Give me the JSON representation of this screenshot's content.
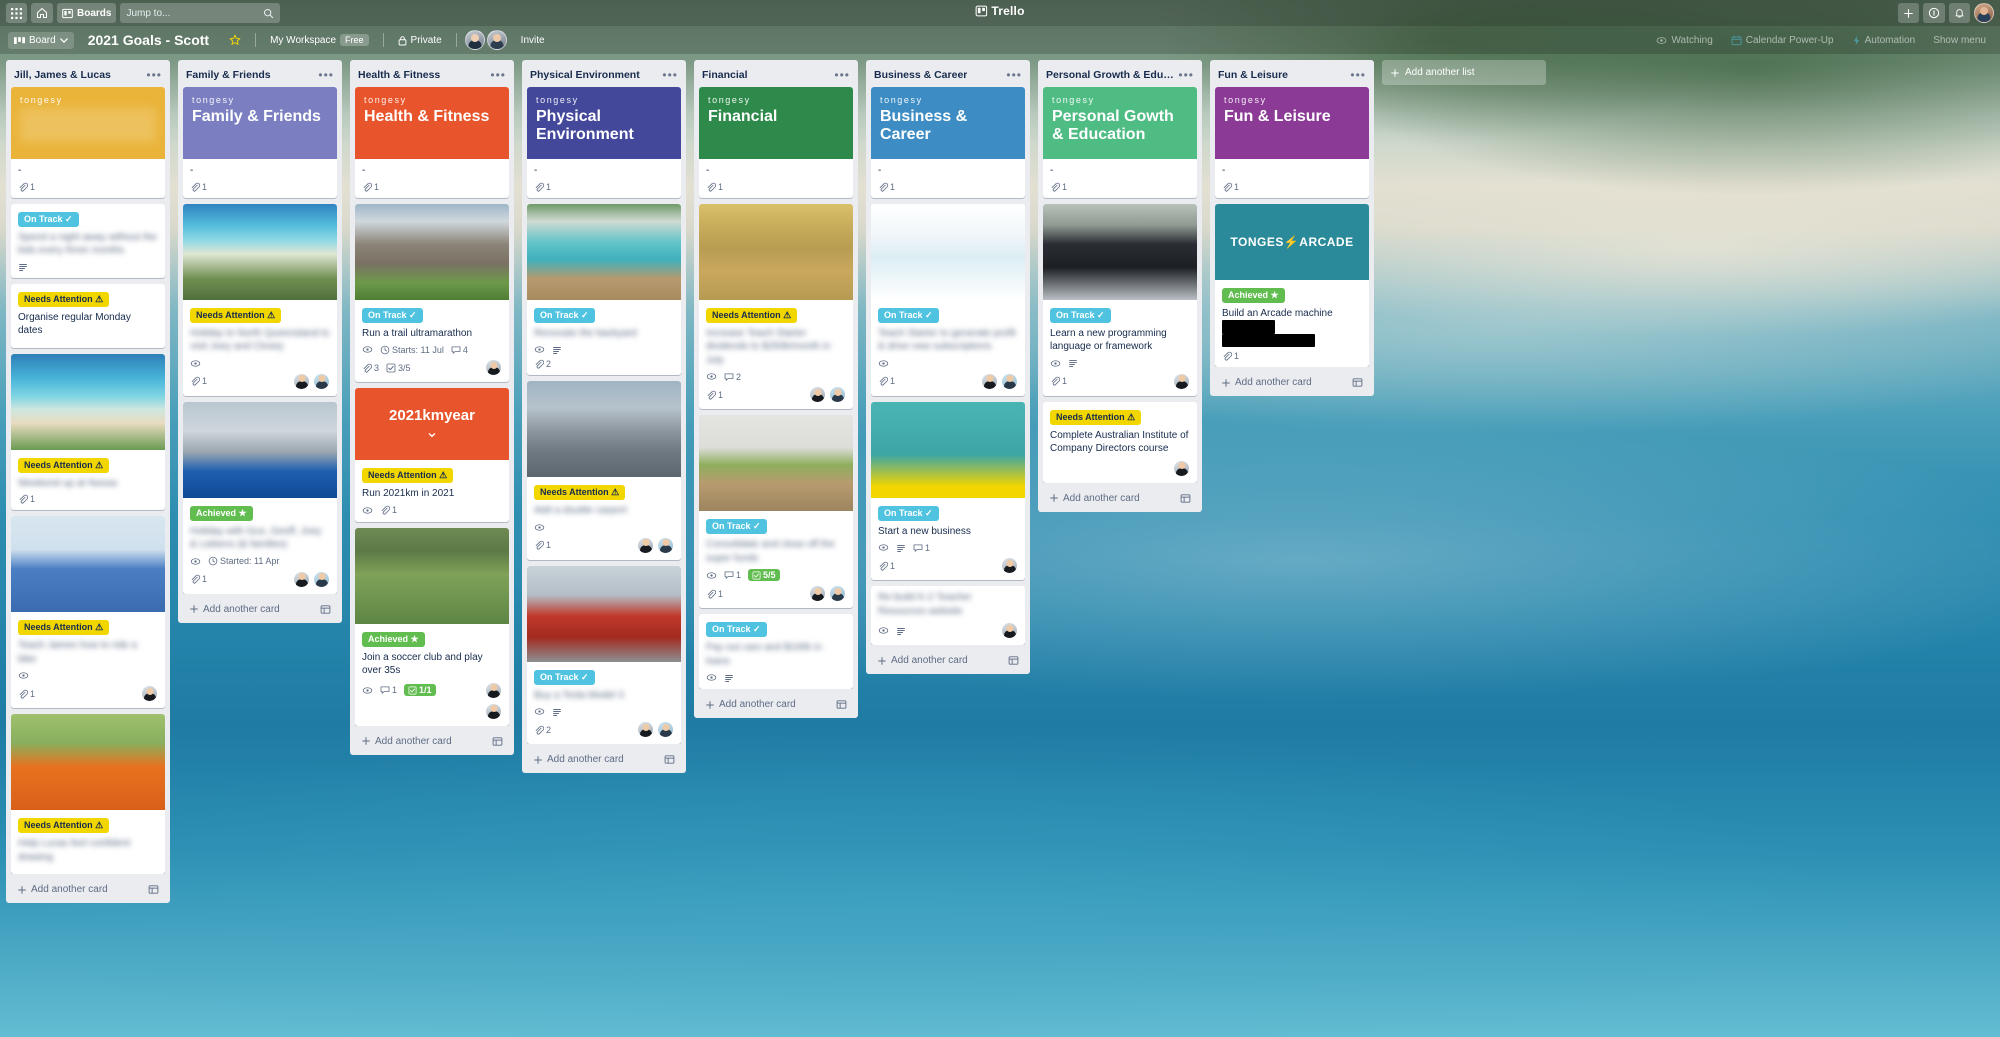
{
  "topnav": {
    "apps_icon": "grid-apps-icon",
    "home_icon": "home-icon",
    "boards_label": "Boards",
    "search_placeholder": "Jump to...",
    "search_icon": "search-icon",
    "brand": "Trello",
    "add_icon": "plus-icon",
    "info_icon": "info-icon",
    "bell_icon": "bell-icon",
    "avatar": "user-avatar"
  },
  "boardbar": {
    "view_label": "Board",
    "view_caret": "chevron-down-icon",
    "title": "2021 Goals - Scott",
    "star_icon": "star-icon",
    "workspace": "My Workspace",
    "plan": "Free",
    "visibility": "Private",
    "lock_icon": "lock-icon",
    "invite_label": "Invite",
    "watching_label": "Watching",
    "calendar_powerup_label": "Calendar Power-Up",
    "automation_label": "Automation",
    "show_menu_label": "Show menu"
  },
  "add_list_label": "Add another list",
  "add_card_label": "Add another card",
  "template_icon": "template-icon",
  "brand_text": "tongesy",
  "colors": {
    "jill": "#eab43a",
    "family": "#7b7fc1",
    "health": "#e8542b",
    "physical": "#43489b",
    "financial": "#2e8a4b",
    "business": "#3d8dc4",
    "growth": "#4fbc84",
    "fun": "#8b3a96",
    "arcade": "#2a8a99",
    "label_ontrack": "#4fc3e0",
    "label_attention": "#f2d600",
    "label_achieved": "#61bd4f"
  },
  "lists": [
    {
      "title": "Jill, James & Lucas",
      "cards": [
        {
          "type": "cover",
          "cover_color": "#eab43a",
          "brand": "tongesy",
          "heading": "",
          "heading_blur": true,
          "title": "-",
          "attach": "1"
        },
        {
          "type": "plain",
          "label": "On Track ✓",
          "label_kind": "ontrack",
          "title": "Spend a night away without the kids every three months",
          "title_blur": true,
          "desc": true
        },
        {
          "type": "plain",
          "label": "Needs Attention ⚠",
          "label_kind": "attention",
          "title": "Organise regular Monday dates",
          "title_blur": false
        },
        {
          "type": "photo",
          "photo": "beach",
          "label": "Needs Attention ⚠",
          "label_kind": "attention",
          "title": "Weekend up at Noosa",
          "title_blur": true,
          "attach": "1"
        },
        {
          "type": "photo",
          "photo": "boy-blue",
          "label": "Needs Attention ⚠",
          "label_kind": "attention",
          "title": "Teach James how to ride a bike",
          "title_blur": true,
          "watch": true,
          "attach": "1",
          "avatars": 1
        },
        {
          "type": "photo",
          "photo": "boy-swing",
          "label": "Needs Attention ⚠",
          "label_kind": "attention",
          "title": "Help Lucas feel confident drawing",
          "title_blur": true
        }
      ]
    },
    {
      "title": "Family & Friends",
      "cards": [
        {
          "type": "cover",
          "cover_color": "#7b7fc1",
          "brand": "tongesy",
          "heading": "Family & Friends",
          "title": "-",
          "attach": "1"
        },
        {
          "type": "photo",
          "photo": "island",
          "label": "Needs Attention ⚠",
          "label_kind": "attention",
          "title": "Holiday to North Queensland to visit Joey and Closey",
          "title_blur": true,
          "watch": true,
          "attach": "1",
          "avatars": 2
        },
        {
          "type": "photo",
          "photo": "house-pool",
          "label": "Achieved ★",
          "label_kind": "achieved",
          "title": "Holiday with Gus, Geoff, Joey & Liebens (& families)",
          "title_blur": true,
          "watch": true,
          "start": "Started: 11 Apr",
          "attach": "1",
          "avatars": 2
        }
      ],
      "add_card": "Add another card"
    },
    {
      "title": "Health & Fitness",
      "cards": [
        {
          "type": "cover",
          "cover_color": "#e8542b",
          "brand": "tongesy",
          "heading": "Health & Fitness",
          "title": "-",
          "attach": "1"
        },
        {
          "type": "photo",
          "photo": "mountain",
          "label": "On Track ✓",
          "label_kind": "ontrack",
          "title": "Run a trail ultramarathon",
          "title_blur": false,
          "watch": true,
          "start": "Starts: 11 Jul",
          "comments": "4",
          "attach": "3",
          "checklist": "3/5",
          "avatars": 1
        },
        {
          "type": "cover-small",
          "cover_color": "#e8542b",
          "cover_text": "2021kmyear",
          "label": "Needs Attention ⚠",
          "label_kind": "attention",
          "title": "Run 2021km in 2021",
          "title_blur": false,
          "watch": true,
          "attach": "1"
        },
        {
          "type": "photo",
          "photo": "soccer",
          "label": "Achieved ★",
          "label_kind": "achieved",
          "title": "Join a soccer club and play over 35s",
          "title_blur": false,
          "watch": true,
          "comments": "1",
          "checklist_green": "1/1",
          "avatars": 1
        }
      ],
      "add_card": "Add another card"
    },
    {
      "title": "Physical Environment",
      "cards": [
        {
          "type": "cover",
          "cover_color": "#43489b",
          "brand": "tongesy",
          "heading": "Physical Environment",
          "title": "-",
          "attach": "1"
        },
        {
          "type": "photo",
          "photo": "pool-lounge",
          "label": "On Track ✓",
          "label_kind": "ontrack",
          "title": "Renovate the backyard",
          "title_blur": true,
          "watch": true,
          "desc": true,
          "attach": "2"
        },
        {
          "type": "photo",
          "photo": "garage",
          "label": "Needs Attention ⚠",
          "label_kind": "attention",
          "title": "Add a double carport",
          "title_blur": true,
          "watch": true,
          "attach": "1",
          "avatars": 2
        },
        {
          "type": "photo",
          "photo": "tesla",
          "label": "On Track ✓",
          "label_kind": "ontrack",
          "title": "Buy a Tesla Model 3",
          "title_blur": true,
          "watch": true,
          "desc": true,
          "attach": "2",
          "avatars": 2
        }
      ],
      "add_card": "Add another card"
    },
    {
      "title": "Financial",
      "cards": [
        {
          "type": "cover",
          "cover_color": "#2e8a4b",
          "brand": "tongesy",
          "heading": "Financial",
          "title": "-",
          "attach": "1"
        },
        {
          "type": "photo",
          "photo": "money",
          "label": "Needs Attention ⚠",
          "label_kind": "attention",
          "title": "Increase Teach Starter dividends to $250k/month in July",
          "title_blur": true,
          "watch": true,
          "comments": "2",
          "attach": "1",
          "avatars": 2
        },
        {
          "type": "photo",
          "photo": "plant-jar",
          "label": "On Track ✓",
          "label_kind": "ontrack",
          "title": "Consolidate and close off the super funds",
          "title_blur": true,
          "watch": true,
          "comments": "1",
          "attach": "1",
          "checklist_green": "5/5",
          "avatars": 2
        },
        {
          "type": "plain",
          "label": "On Track ✓",
          "label_kind": "ontrack",
          "title": "Pay out cars and $100k in loans",
          "title_blur": true,
          "watch": true,
          "desc": true
        }
      ],
      "add_card": "Add another card"
    },
    {
      "title": "Business & Career",
      "cards": [
        {
          "type": "cover",
          "cover_color": "#3d8dc4",
          "brand": "tongesy",
          "heading": "Business & Career",
          "title": "-",
          "attach": "1"
        },
        {
          "type": "photo",
          "photo": "teaching-resources",
          "label": "On Track ✓",
          "label_kind": "ontrack",
          "title": "Teach Starter to generate profit & drive new subscriptions",
          "title_blur": true,
          "watch": true,
          "attach": "1",
          "avatars": 2
        },
        {
          "type": "photo",
          "photo": "teach-banner",
          "label": "On Track ✓",
          "label_kind": "ontrack",
          "title": "Start a new business",
          "title_blur": false,
          "watch": true,
          "desc": true,
          "comments": "1",
          "attach": "1",
          "avatars": 1
        },
        {
          "type": "plain",
          "label": "",
          "label_kind": "",
          "title": "Re-build K-2 Teacher Resources website",
          "title_blur": true,
          "watch": true,
          "desc": true,
          "avatars": 1
        }
      ],
      "add_card": "Add another card"
    },
    {
      "title": "Personal Growth & Education",
      "cards": [
        {
          "type": "cover",
          "cover_color": "#4fbc84",
          "brand": "tongesy",
          "heading": "Personal Gowth & Education",
          "title": "-",
          "attach": "1"
        },
        {
          "type": "photo",
          "photo": "laptop-code",
          "label": "On Track ✓",
          "label_kind": "ontrack",
          "title": "Learn a new programming language or framework",
          "title_blur": false,
          "watch": true,
          "desc": true,
          "attach": "1",
          "avatars": 1
        },
        {
          "type": "plain",
          "label": "Needs Attention ⚠",
          "label_kind": "attention",
          "title": "Complete Australian Institute of Company Directors course",
          "title_blur": false,
          "avatars": 1
        }
      ],
      "add_card": "Add another card"
    },
    {
      "title": "Fun & Leisure",
      "cards": [
        {
          "type": "cover",
          "cover_color": "#8b3a96",
          "brand": "tongesy",
          "heading": "Fun & Leisure",
          "title": "-",
          "attach": "1"
        },
        {
          "type": "arcade",
          "cover_color": "#2a8a99",
          "arcade_text": "TONGES⚡ARCADE",
          "label": "Achieved ★",
          "label_kind": "achieved",
          "title": "Build an Arcade machine",
          "redacted": true,
          "attach": "1"
        }
      ],
      "add_card": "Add another card"
    }
  ]
}
